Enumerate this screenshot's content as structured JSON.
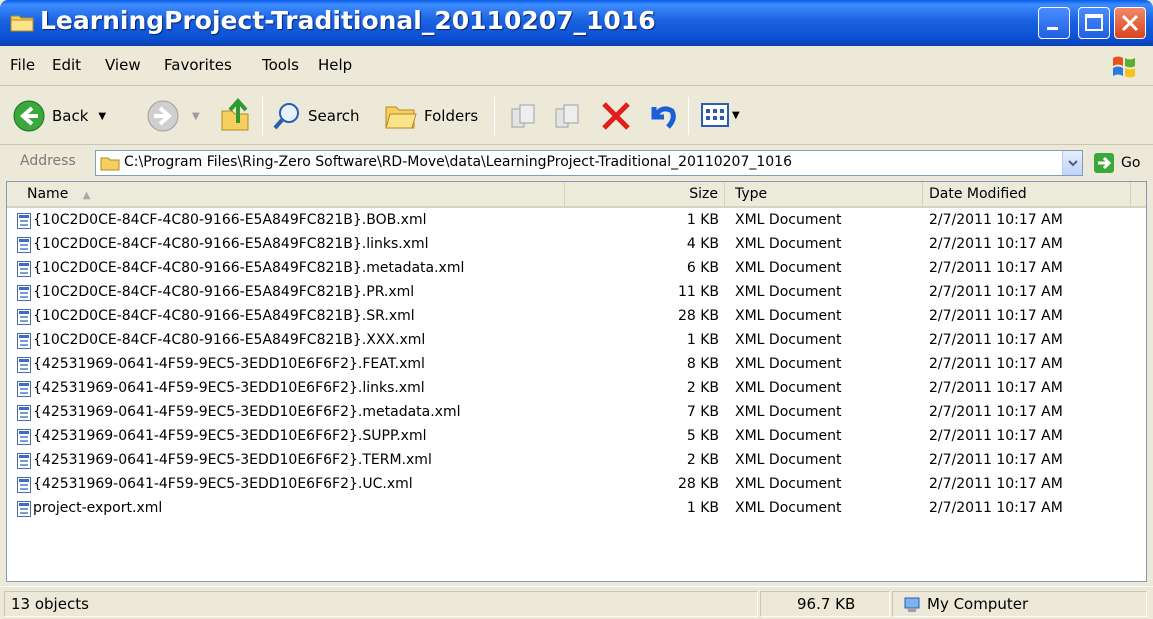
{
  "window": {
    "title": "LearningProject-Traditional_20110207_1016"
  },
  "menu": {
    "items": [
      "File",
      "Edit",
      "View",
      "Favorites",
      "Tools",
      "Help"
    ]
  },
  "toolbar": {
    "back_label": "Back",
    "search_label": "Search",
    "folders_label": "Folders"
  },
  "address": {
    "label": "Address",
    "path": "C:\\Program Files\\Ring-Zero Software\\RD-Move\\data\\LearningProject-Traditional_20110207_1016",
    "go_label": "Go"
  },
  "list": {
    "columns": [
      "Name",
      "Size",
      "Type",
      "Date Modified"
    ],
    "rows": [
      {
        "name": "{10C2D0CE-84CF-4C80-9166-E5A849FC821B}.BOB.xml",
        "size": "1 KB",
        "type": "XML Document",
        "date": "2/7/2011 10:17 AM"
      },
      {
        "name": "{10C2D0CE-84CF-4C80-9166-E5A849FC821B}.links.xml",
        "size": "4 KB",
        "type": "XML Document",
        "date": "2/7/2011 10:17 AM"
      },
      {
        "name": "{10C2D0CE-84CF-4C80-9166-E5A849FC821B}.metadata.xml",
        "size": "6 KB",
        "type": "XML Document",
        "date": "2/7/2011 10:17 AM"
      },
      {
        "name": "{10C2D0CE-84CF-4C80-9166-E5A849FC821B}.PR.xml",
        "size": "11 KB",
        "type": "XML Document",
        "date": "2/7/2011 10:17 AM"
      },
      {
        "name": "{10C2D0CE-84CF-4C80-9166-E5A849FC821B}.SR.xml",
        "size": "28 KB",
        "type": "XML Document",
        "date": "2/7/2011 10:17 AM"
      },
      {
        "name": "{10C2D0CE-84CF-4C80-9166-E5A849FC821B}.XXX.xml",
        "size": "1 KB",
        "type": "XML Document",
        "date": "2/7/2011 10:17 AM"
      },
      {
        "name": "{42531969-0641-4F59-9EC5-3EDD10E6F6F2}.FEAT.xml",
        "size": "8 KB",
        "type": "XML Document",
        "date": "2/7/2011 10:17 AM"
      },
      {
        "name": "{42531969-0641-4F59-9EC5-3EDD10E6F6F2}.links.xml",
        "size": "2 KB",
        "type": "XML Document",
        "date": "2/7/2011 10:17 AM"
      },
      {
        "name": "{42531969-0641-4F59-9EC5-3EDD10E6F6F2}.metadata.xml",
        "size": "7 KB",
        "type": "XML Document",
        "date": "2/7/2011 10:17 AM"
      },
      {
        "name": "{42531969-0641-4F59-9EC5-3EDD10E6F6F2}.SUPP.xml",
        "size": "5 KB",
        "type": "XML Document",
        "date": "2/7/2011 10:17 AM"
      },
      {
        "name": "{42531969-0641-4F59-9EC5-3EDD10E6F6F2}.TERM.xml",
        "size": "2 KB",
        "type": "XML Document",
        "date": "2/7/2011 10:17 AM"
      },
      {
        "name": "{42531969-0641-4F59-9EC5-3EDD10E6F6F2}.UC.xml",
        "size": "28 KB",
        "type": "XML Document",
        "date": "2/7/2011 10:17 AM"
      },
      {
        "name": "project-export.xml",
        "size": "1 KB",
        "type": "XML Document",
        "date": "2/7/2011 10:17 AM"
      }
    ]
  },
  "status": {
    "objects": "13 objects",
    "size": "96.7 KB",
    "location": "My Computer"
  },
  "colors": {
    "titlebar": "#0b4fd2",
    "chrome": "#ece9d8",
    "close_button": "#d8441e"
  }
}
